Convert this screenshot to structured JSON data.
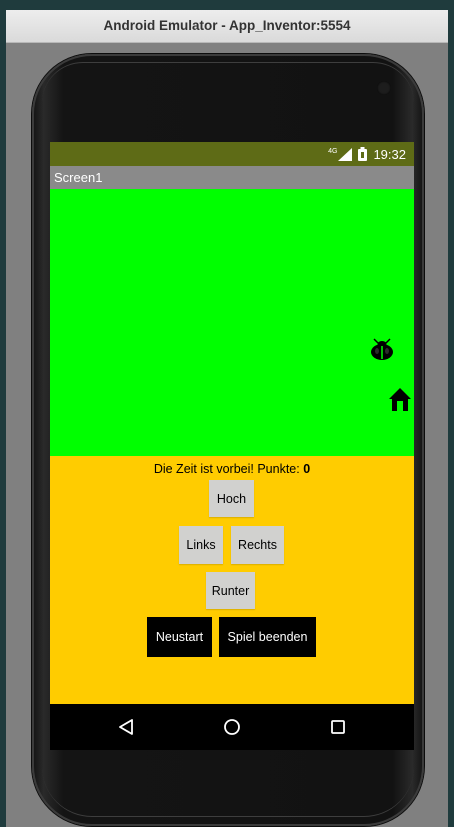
{
  "window": {
    "title": "Android Emulator - App_Inventor:5554"
  },
  "statusbar": {
    "network": "4G",
    "time": "19:32"
  },
  "appbar": {
    "title": "Screen1"
  },
  "game": {
    "canvas_color": "#00ff00",
    "sprites": [
      {
        "name": "ladybug-sprite",
        "icon": "ladybug-icon"
      },
      {
        "name": "home-sprite",
        "icon": "home-icon"
      }
    ]
  },
  "controls": {
    "panel_color": "#ffcc00",
    "message": "Die Zeit ist vorbei! Punkte:",
    "score": "0",
    "up": "Hoch",
    "left": "Links",
    "right": "Rechts",
    "down": "Runter",
    "restart": "Neustart",
    "quit": "Spiel beenden"
  },
  "navbar": {
    "icons": [
      "back-icon",
      "home-circle-icon",
      "recents-icon"
    ]
  },
  "colors": {
    "statusbar": "#5e6b16",
    "appbar": "#8a8a8a",
    "button_grey": "#d1d1cf",
    "button_black": "#000000"
  }
}
